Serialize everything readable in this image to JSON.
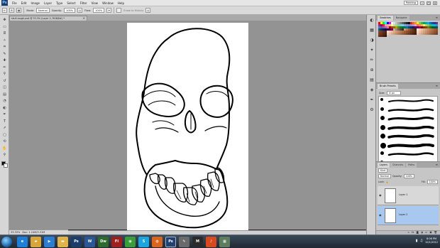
{
  "app": {
    "logo_text": "Ps",
    "menu": [
      "File",
      "Edit",
      "Image",
      "Layer",
      "Type",
      "Select",
      "Filter",
      "View",
      "Window",
      "Help"
    ],
    "workspace": "Painting",
    "window_controls": [
      "–",
      "□",
      "×"
    ]
  },
  "options": {
    "brush_size": "8",
    "mode_label": "Mode:",
    "mode_value": "Normal",
    "opacity_label": "Opacity:",
    "opacity_value": "100%",
    "flow_label": "Flow:",
    "flow_value": "100%",
    "erase_label": "Erase to History"
  },
  "document": {
    "tab_title": "skull-rough.psd @ 33.3% (Layer 2, RGB/8#) *",
    "close_glyph": "×",
    "zoom": "33.33%",
    "doc_info": "Doc: 1.24M/3.31M"
  },
  "tools": [
    {
      "name": "move-tool",
      "glyph": "✥"
    },
    {
      "name": "marquee-tool",
      "glyph": "▭"
    },
    {
      "name": "lasso-tool",
      "glyph": "ᘓ"
    },
    {
      "name": "quick-select-tool",
      "glyph": "✧"
    },
    {
      "name": "crop-tool",
      "glyph": "⌗"
    },
    {
      "name": "eyedropper-tool",
      "glyph": "✎"
    },
    {
      "name": "healing-tool",
      "glyph": "✚"
    },
    {
      "name": "brush-tool",
      "glyph": "✏"
    },
    {
      "name": "clone-stamp-tool",
      "glyph": "⚲"
    },
    {
      "name": "history-brush-tool",
      "glyph": "↺"
    },
    {
      "name": "eraser-tool",
      "glyph": "◫"
    },
    {
      "name": "gradient-tool",
      "glyph": "▤"
    },
    {
      "name": "blur-tool",
      "glyph": "◔"
    },
    {
      "name": "dodge-tool",
      "glyph": "◐"
    },
    {
      "name": "pen-tool",
      "glyph": "✒"
    },
    {
      "name": "type-tool",
      "glyph": "T"
    },
    {
      "name": "path-select-tool",
      "glyph": "➚"
    },
    {
      "name": "shape-tool",
      "glyph": "▢"
    },
    {
      "name": "3d-rotate-tool",
      "glyph": "⟲"
    },
    {
      "name": "hand-tool",
      "glyph": "✋"
    },
    {
      "name": "zoom-tool",
      "glyph": "⚲"
    }
  ],
  "dock_icons": [
    "color-icon",
    "swatches-icon",
    "adjustments-icon",
    "styles-icon",
    "brush-icon",
    "clone-source-icon",
    "layers-icon",
    "channels-icon",
    "paths-icon",
    "tool-presets-icon"
  ],
  "swatches_panel": {
    "tabs": [
      "Swatches",
      "Navigator"
    ],
    "menu_glyph": "≡",
    "colors": [
      "#ff0000",
      "#ffff00",
      "#00ff00",
      "#00ffff",
      "#0000ff",
      "#ff00ff",
      "#ffffff",
      "#e0e0e0",
      "#c0c0c0",
      "#a0a0a0",
      "#808080",
      "#606060",
      "#404040",
      "#202020",
      "#000000",
      "#ed1c24",
      "#f26522",
      "#f7941d",
      "#fff200",
      "#8dc63f",
      "#39b54a",
      "#00a651",
      "#00a99d",
      "#00aeef",
      "#0072bc",
      "#0054a6",
      "#2e3192",
      "#662d91",
      "#92278f",
      "#9e005d",
      "#ed145b",
      "#f5989d",
      "#f9ad81",
      "#fdc689",
      "#fff799",
      "#c4df9b",
      "#a3d39c",
      "#82ca9c",
      "#7accc8",
      "#6dcff6",
      "#7da7d9",
      "#8393ca",
      "#8781bd",
      "#a187be",
      "#bd8cbf",
      "#f49ac1",
      "#f26c4f",
      "#f68e56",
      "#fbaf5d",
      "#fff568",
      "#acd373",
      "#7cc576",
      "#3cb878",
      "#1cbbb4",
      "#00bff3",
      "#448ccb",
      "#5674b9",
      "#605ca8",
      "#855fa8",
      "#a864a8",
      "#f06eaa",
      "#9e0b0f",
      "#a0410d",
      "#a36209",
      "#aba000",
      "#598527",
      "#197b30",
      "#007236",
      "#00746b",
      "#0076a3",
      "#004a80",
      "#003471",
      "#1b1464",
      "#440e62",
      "#630460",
      "#9e005d",
      "#790000",
      "#7b2e00",
      "#7d4900",
      "#827b00",
      "#406618",
      "#005e20",
      "#005826",
      "#005952",
      "#005b7f",
      "#003663",
      "#002157",
      "#0d004c",
      "#32004b",
      "#4b0049",
      "#7b0046",
      "#c7b299",
      "#998675",
      "#736357",
      "#534741",
      "#37302a",
      "#c69c6d",
      "#a67c52",
      "#8c6239",
      "#754c24",
      "#603913",
      "#3c2415",
      "#f7e1d0",
      "#f2d0b8",
      "#e8bfa0",
      "#ddb08c",
      "#d1a07a",
      "#c49068",
      "#b78058",
      "#a9704a",
      "#9b613d",
      "#8d5332",
      "#7f4628",
      "#6f3a20",
      "#5f2f19",
      "#4f2513",
      "#f5dccb",
      "#efcbb3",
      "#e6ba9c",
      "#dcaa88",
      "#d19a76",
      "#c48a64",
      "#b77b55",
      "#a96d48",
      "#9b5f3c",
      "#8c5231",
      "#7e4528",
      "#6e3920",
      "#5e2e19",
      "#4e2413",
      "#f3d5c3",
      "#ebc3aa",
      "#e1b293",
      "#d6a27e",
      "#ca926c",
      "#bd825b",
      "#b0734d",
      "#a26540",
      "#945835",
      "#864b2b",
      "#773f22",
      "#68341b",
      "#582a15",
      "#48200f",
      "#f0cfbc",
      "#e7bca3",
      "#dcab8c",
      "#d09b77",
      "#c48b65",
      "#b77c55",
      "#a96e48",
      "#9b603b",
      "#8d5330",
      "#7e4626",
      "#6f3a1e",
      "#602f17",
      "#512512",
      "#421c0d",
      "#eccab5",
      "#e2b69d",
      "#d6a586",
      "#ca9572",
      "#bd8560",
      "#b07651",
      "#a26844",
      "#945a38",
      "#864d2e",
      "#774124",
      "#68351c",
      "#592b16",
      "#4a2110",
      "#3c180b"
    ]
  },
  "brush_panel": {
    "title": "Brush Presets",
    "size_label": "Size:",
    "size_value": "8 px",
    "menu_glyph": "≡"
  },
  "layers_panel": {
    "tabs": [
      "Layers",
      "Channels",
      "Paths"
    ],
    "menu_glyph": "≡",
    "kind_label": "Kind",
    "blend_mode": "Normal",
    "opacity_label": "Opacity:",
    "opacity_value": "100%",
    "lock_label": "Lock:",
    "fill_label": "Fill:",
    "fill_value": "100%",
    "layers": [
      {
        "name": "Layer 1",
        "visible": true,
        "selected": false
      },
      {
        "name": "Layer 2",
        "visible": true,
        "selected": true
      }
    ],
    "footer_icons": [
      "link-icon",
      "fx-icon",
      "mask-icon",
      "adjustment-icon",
      "group-icon",
      "new-layer-icon",
      "trash-icon"
    ]
  },
  "taskbar": {
    "apps": [
      {
        "name": "ie-icon",
        "glyph": "e",
        "color": "#1e7fd8"
      },
      {
        "name": "explorer-icon",
        "glyph": "▰",
        "color": "#d8a53a"
      },
      {
        "name": "media-icon",
        "glyph": "▶",
        "color": "#2a7dd1"
      },
      {
        "name": "folder-icon",
        "glyph": "▬",
        "color": "#e0b44a"
      },
      {
        "name": "ps-icon",
        "glyph": "Ps",
        "color": "#1c3d6b"
      },
      {
        "name": "word-icon",
        "glyph": "W",
        "color": "#2b5797"
      },
      {
        "name": "dw-icon",
        "glyph": "Dw",
        "color": "#2d6a2d"
      },
      {
        "name": "fl-icon",
        "glyph": "Fl",
        "color": "#a01e1e"
      },
      {
        "name": "chrome-icon",
        "glyph": "◉",
        "color": "#3a9d3a"
      },
      {
        "name": "skype-icon",
        "glyph": "S",
        "color": "#1aa5e0"
      },
      {
        "name": "firefox-icon",
        "glyph": "◍",
        "color": "#d8641e"
      },
      {
        "name": "ps-active-icon",
        "glyph": "Ps",
        "color": "#23406e"
      },
      {
        "name": "paint-icon",
        "glyph": "✎",
        "color": "#6a6a6a"
      },
      {
        "name": "monster-icon",
        "glyph": "M",
        "color": "#2a2a2a"
      },
      {
        "name": "media2-icon",
        "glyph": "♪",
        "color": "#d84a1e"
      },
      {
        "name": "app-icon",
        "glyph": "▦",
        "color": "#5e7c5e"
      }
    ],
    "time": "8:06 PM",
    "date": "10/1/2012"
  }
}
